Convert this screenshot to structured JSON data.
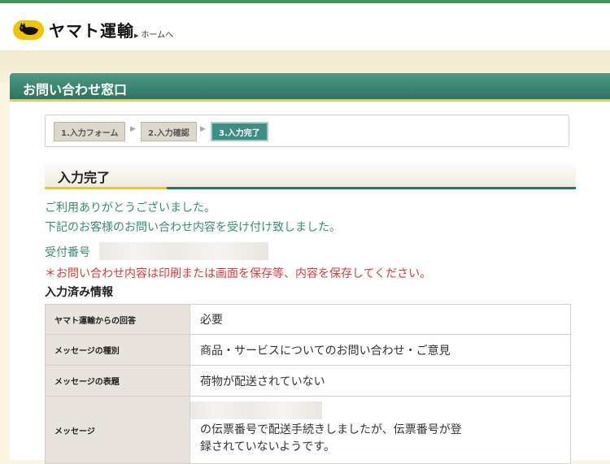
{
  "header": {
    "logo_text": "ヤマト運輸",
    "logo_icon": "black-cat-icon",
    "home_link": "ホームへ"
  },
  "panel": {
    "title": "お問い合わせ窓口"
  },
  "steps": [
    {
      "label": "1.入力フォーム",
      "active": false
    },
    {
      "label": "2.入力確認",
      "active": false
    },
    {
      "label": "3.入力完了",
      "active": true
    }
  ],
  "section": {
    "title": "入力完了"
  },
  "messages": {
    "thanks": "ご利用ありがとうございました。",
    "received": "下記のお客様のお問い合わせ内容を受け付け致しました。",
    "receipt_label": "受付番号",
    "warning": "＊お問い合わせ内容は印刷または画面を保存等、内容を保存してください。"
  },
  "info": {
    "title": "入力済み情報",
    "rows": [
      {
        "label": "ヤマト運輸からの回答",
        "value": "必要"
      },
      {
        "label": "メッセージの種別",
        "value": "商品・サービスについてのお問い合わせ・ご意見"
      },
      {
        "label": "メッセージの表題",
        "value": "荷物が配送されていない"
      },
      {
        "label": "メッセージ",
        "line1": "の伝票番号で配送手続きしましたが、伝票番号が登",
        "line2": "録されていないようです。"
      }
    ]
  },
  "colors": {
    "accent_green": "#2e7460",
    "text_green": "#3b8a78",
    "warning_red": "#d23c3c",
    "gold": "#e8c43d"
  }
}
